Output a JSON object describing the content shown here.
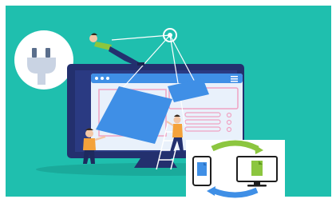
{
  "scene": {
    "background_color": "#1fbfae",
    "frame_color": "#ffffff",
    "monitor_color": "#23306e",
    "screen_color": "#e9f1fb",
    "accent_blue": "#3f8fe6",
    "accent_green": "#8cc63f",
    "accent_orange": "#f4a23a",
    "outline_pink": "#f0a3c3"
  },
  "icons": [
    "power-plug-icon",
    "pulley-icon",
    "hamburger-menu-icon",
    "smartphone-document-icon",
    "desktop-document-icon",
    "sync-cycle-icon"
  ]
}
